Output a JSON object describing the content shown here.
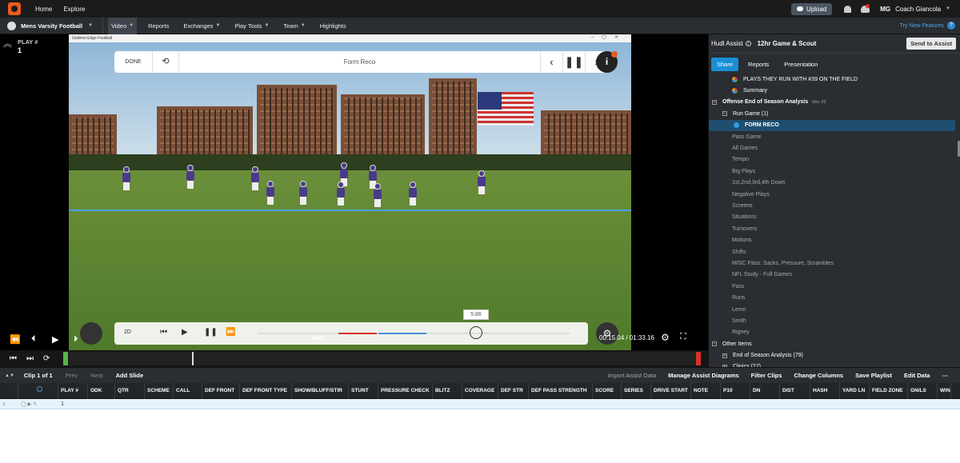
{
  "topnav": {
    "links": [
      "Home",
      "Explore"
    ],
    "upload_label": "Upload",
    "user_initials": "MG",
    "user_name": "Coach Giancola"
  },
  "subnav": {
    "team_name": "Mens Varsity Football",
    "menu": [
      "Video",
      "Reports",
      "Exchanges",
      "Play Tools",
      "Team",
      "Highlights"
    ],
    "try_new": "Try New Features"
  },
  "play": {
    "label": "PLAY #",
    "number": "1"
  },
  "video": {
    "window_title": "Gridiron Edge Football",
    "done_label": "DONE",
    "hud_title": "Form Reco",
    "info_label": "i",
    "btn_2d": "2D",
    "time_tip": "5.86",
    "undo_label": "Undo",
    "time_display": "00:15.04 / 01:33.16"
  },
  "sidebar": {
    "title": "Hudl Assist",
    "game": "12hr Game & Scout",
    "send_label": "Send to Assist",
    "tabs": [
      "Share",
      "Reports",
      "Presentation"
    ],
    "tree": [
      {
        "label": "PLAYS THEY RUN WITH #39 ON THE FIELD",
        "type": "multi"
      },
      {
        "label": "Summary",
        "type": "multi"
      },
      {
        "label": "Offense End of Season Analysis",
        "meta": "Dec 20",
        "type": "group"
      },
      {
        "label": "Run Game (1)",
        "type": "subgroup"
      },
      {
        "label": "FORM RECO",
        "type": "selected"
      },
      {
        "label": "Pass Game"
      },
      {
        "label": "All Games"
      },
      {
        "label": "Tempo"
      },
      {
        "label": "Big Plays"
      },
      {
        "label": "1st,2nd,3rd,4th Down"
      },
      {
        "label": "Negative Plays"
      },
      {
        "label": "Screens"
      },
      {
        "label": "Situations"
      },
      {
        "label": "Turnovers"
      },
      {
        "label": "Motions"
      },
      {
        "label": "Shifts"
      },
      {
        "label": "MISC Pass: Sacks, Pressure, Scrambles"
      },
      {
        "label": "NFL Study - Full Games"
      },
      {
        "label": "Pass"
      },
      {
        "label": "Runs"
      },
      {
        "label": "Lemn"
      },
      {
        "label": "Smith"
      },
      {
        "label": "Rigney"
      },
      {
        "label": "Other Items",
        "type": "group"
      },
      {
        "label": "End of Season Analysis (79)",
        "type": "subgroup"
      },
      {
        "label": "Clinics (27)",
        "type": "subgroup"
      }
    ]
  },
  "clipbar": {
    "clip_label": "Clip 1 of 1",
    "prev": "Prev",
    "next": "Next",
    "add_slide": "Add Slide",
    "import": "Import Assist Data",
    "actions": [
      "Manage Assist Diagrams",
      "Filter Clips",
      "Change Columns",
      "Save Playlist",
      "Edit Data"
    ],
    "more": "⋯"
  },
  "grid": {
    "columns": [
      "PLAY #",
      "ODK",
      "QTR",
      "SCHEME",
      "CALL",
      "DEF FRONT",
      "DEF FRONT TYPE",
      "SHOW/BLUFF/STIR",
      "STUNT",
      "PRESSURE CHECK",
      "BLITZ",
      "COVERAGE",
      "DEF STR",
      "DEF PASS STRENGTH",
      "SCORE",
      "SERIES",
      "DRIVE START",
      "NOTE",
      "P10",
      "DN",
      "DIST",
      "HASH",
      "YARD LN",
      "FIELD ZONE",
      "GN/LS",
      "WINAR"
    ],
    "rows": [
      [
        "1"
      ]
    ]
  }
}
